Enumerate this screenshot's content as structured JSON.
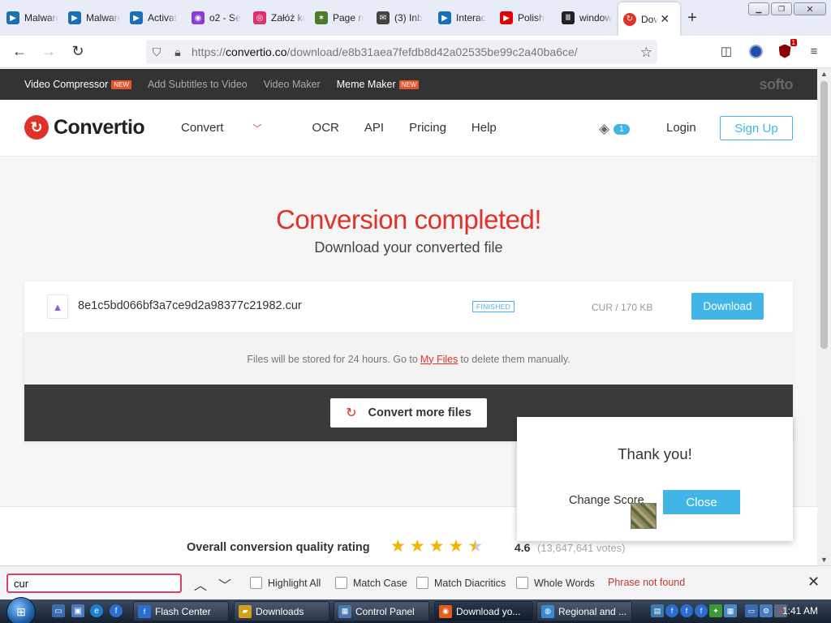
{
  "browser": {
    "tabs": [
      {
        "label": "Malware",
        "icon": "malwarebytes-icon",
        "color": "#1a6fb5"
      },
      {
        "label": "Malware",
        "icon": "malwarebytes-icon",
        "color": "#1a6fb5"
      },
      {
        "label": "Activat",
        "icon": "malwarebytes-icon",
        "color": "#1a6fb5"
      },
      {
        "label": "o2 - Se",
        "icon": "o2-icon",
        "color": "#8a3ad8"
      },
      {
        "label": "Załóż ko",
        "icon": "instagram-icon",
        "color": "#d6336c"
      },
      {
        "label": "Page n",
        "icon": "bug-icon",
        "color": "#4a7a2a"
      },
      {
        "label": "(3) Inb",
        "icon": "mail-icon",
        "color": "#444444"
      },
      {
        "label": "Interac",
        "icon": "malwarebytes-icon",
        "color": "#1a6fb5"
      },
      {
        "label": "Polish",
        "icon": "youtube-icon",
        "color": "#e00000"
      },
      {
        "label": "window",
        "icon": "wikipedia-icon",
        "color": "#222222"
      }
    ],
    "active_tab": {
      "label": "Dov",
      "icon": "convertio-icon",
      "color": "#e0322b"
    },
    "url_prefix": "https://",
    "url_domain": "convertio.co",
    "url_path": "/download/e8b31aea7fefdb8d42a02535be99c2a40ba6ce/"
  },
  "softo_bar": {
    "links": [
      {
        "label": "Video Compressor",
        "badge": "NEW"
      },
      {
        "label": "Add Subtitles to Video",
        "badge": ""
      },
      {
        "label": "Video Maker",
        "badge": ""
      },
      {
        "label": "Meme Maker",
        "badge": "NEW"
      }
    ],
    "brand": "softo"
  },
  "header": {
    "logo_text": "Convertio",
    "nav": {
      "convert": "Convert",
      "ocr": "OCR",
      "api": "API",
      "pricing": "Pricing",
      "help": "Help"
    },
    "queue_count": "1",
    "login": "Login",
    "signup": "Sign Up"
  },
  "main": {
    "title": "Conversion completed!",
    "subtitle": "Download your converted file",
    "file": {
      "name": "8e1c5bd066bf3a7ce9d2a98377c21982.cur",
      "status": "FINISHED",
      "meta": "CUR / 170 KB",
      "download": "Download"
    },
    "stored_before": "Files will be stored for 24 hours. Go to",
    "my_files": "My Files",
    "stored_after": "to delete them manually.",
    "convert_more": "Convert more files"
  },
  "rating": {
    "label": "Overall conversion quality rating",
    "score": "4.6",
    "votes": "(13,647,641 votes)",
    "stars_value": 4.6
  },
  "popup": {
    "title": "Thank you!",
    "change_score": "Change Score",
    "close": "Close"
  },
  "findbar": {
    "query": "cur",
    "highlight_all": "Highlight All",
    "match_case": "Match Case",
    "match_diacritics": "Match Diacritics",
    "whole_words": "Whole Words",
    "status": "Phrase not found"
  },
  "taskbar": {
    "items": [
      {
        "label": "Flash Center",
        "icon": "flash-icon",
        "color": "#2a6fd0"
      },
      {
        "label": "Downloads",
        "icon": "folder-icon",
        "color": "#d0a020"
      },
      {
        "label": "Control Panel",
        "icon": "control-panel-icon",
        "color": "#4a7ab0"
      },
      {
        "label": "Download yo...",
        "icon": "firefox-icon",
        "color": "#e0601a"
      },
      {
        "label": "Regional and ...",
        "icon": "globe-icon",
        "color": "#3a8ad0"
      }
    ],
    "clock": "1:41 AM"
  }
}
